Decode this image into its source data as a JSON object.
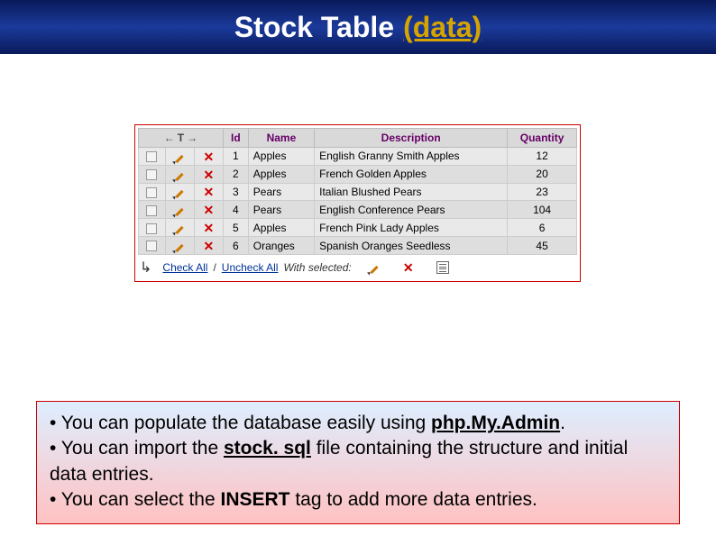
{
  "title": {
    "main": "Stock Table",
    "sub": "(data)"
  },
  "table": {
    "headers": {
      "id": "Id",
      "name": "Name",
      "description": "Description",
      "quantity": "Quantity"
    },
    "rows": [
      {
        "id": "1",
        "name": "Apples",
        "desc": "English Granny Smith Apples",
        "qty": "12"
      },
      {
        "id": "2",
        "name": "Apples",
        "desc": "French Golden Apples",
        "qty": "20"
      },
      {
        "id": "3",
        "name": "Pears",
        "desc": "Italian Blushed Pears",
        "qty": "23"
      },
      {
        "id": "4",
        "name": "Pears",
        "desc": "English Conference Pears",
        "qty": "104"
      },
      {
        "id": "5",
        "name": "Apples",
        "desc": "French Pink Lady Apples",
        "qty": "6"
      },
      {
        "id": "6",
        "name": "Oranges",
        "desc": "Spanish Oranges Seedless",
        "qty": "45"
      }
    ]
  },
  "footer": {
    "check_all": "Check All",
    "uncheck_all": "Uncheck All",
    "with_selected": "With selected:"
  },
  "notes": {
    "b1_pre": "• You can populate the database easily using ",
    "b1_bold": "php.My.Admin",
    "b1_post": ".",
    "b2_pre": "• You can import the ",
    "b2_bold": "stock. sql",
    "b2_post": " file containing the structure and initial data entries.",
    "b3_pre": "• You can select the ",
    "b3_bold": "INSERT",
    "b3_post": " tag to add more data entries."
  }
}
